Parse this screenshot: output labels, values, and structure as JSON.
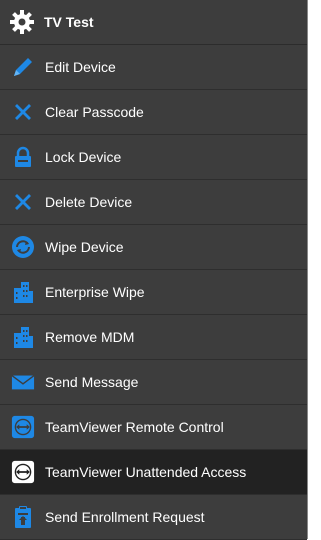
{
  "header": {
    "title": "TV Test",
    "icon": "gear-icon"
  },
  "menu": {
    "items": [
      {
        "label": "Edit Device",
        "icon": "pencil-icon"
      },
      {
        "label": "Clear Passcode",
        "icon": "x-icon"
      },
      {
        "label": "Lock Device",
        "icon": "lock-icon"
      },
      {
        "label": "Delete Device",
        "icon": "x-icon"
      },
      {
        "label": "Wipe Device",
        "icon": "wipe-icon"
      },
      {
        "label": "Enterprise Wipe",
        "icon": "buildings-icon"
      },
      {
        "label": "Remove MDM",
        "icon": "buildings-icon"
      },
      {
        "label": "Send Message",
        "icon": "envelope-icon"
      },
      {
        "label": "TeamViewer Remote Control",
        "icon": "teamviewer-icon"
      },
      {
        "label": "TeamViewer Unattended Access",
        "icon": "teamviewer-icon",
        "selected": true
      },
      {
        "label": "Send Enrollment Request",
        "icon": "clipboard-icon"
      }
    ]
  },
  "colors": {
    "menu_bg": "#3d3d3d",
    "selected_bg": "#222222",
    "icon_blue": "#1e88e5",
    "text": "#ffffff"
  }
}
